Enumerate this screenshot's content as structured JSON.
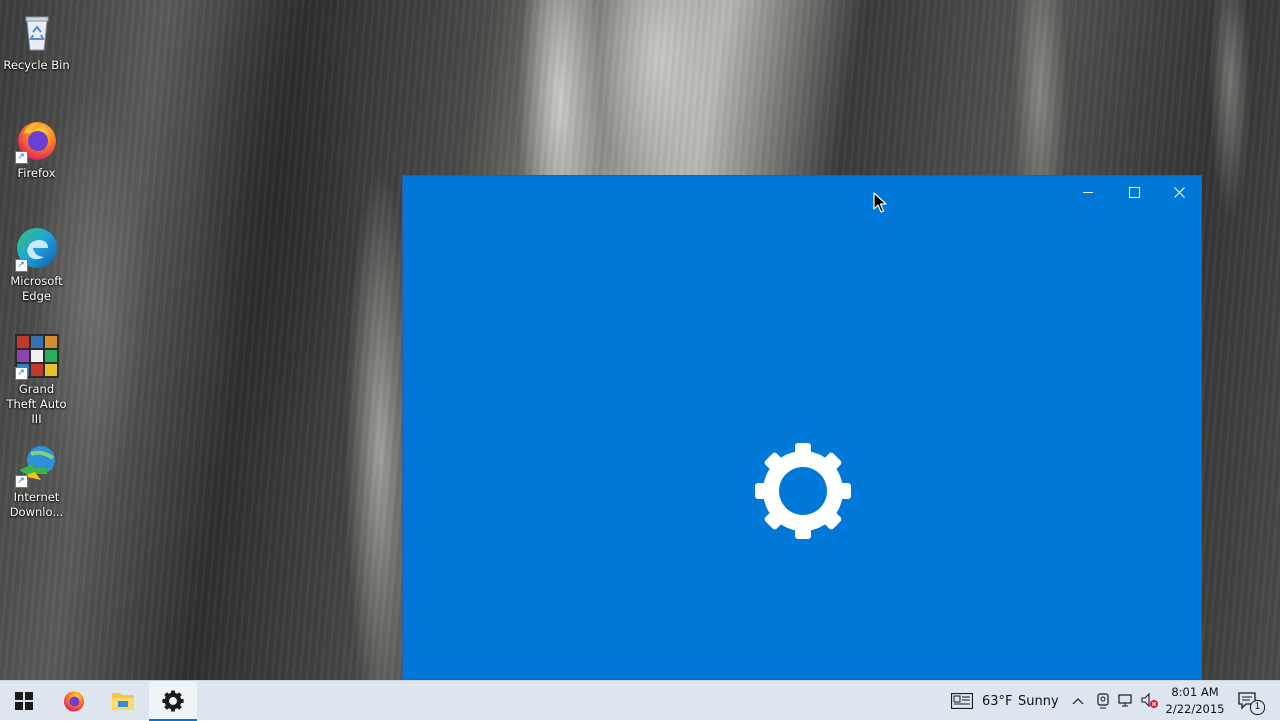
{
  "desktop": {
    "icons": [
      {
        "label": "Recycle Bin",
        "icon": "recycle-bin-icon"
      },
      {
        "label": "Firefox",
        "icon": "firefox-icon"
      },
      {
        "label": "Microsoft Edge",
        "icon": "edge-icon"
      },
      {
        "label": "Grand Theft Auto III",
        "icon": "gta3-icon"
      },
      {
        "label": "Internet Downlo...",
        "icon": "internet-download-manager-icon"
      }
    ]
  },
  "window": {
    "app": "Settings",
    "splash_icon": "gear-icon",
    "background_color": "#0078d7",
    "controls": {
      "minimize": "minimize-icon",
      "maximize": "maximize-icon",
      "close": "close-icon"
    }
  },
  "taskbar": {
    "start_icon": "windows-start-icon",
    "pinned": [
      {
        "name": "Firefox",
        "icon": "firefox-icon",
        "active": false
      },
      {
        "name": "File Explorer",
        "icon": "folder-icon",
        "active": false
      },
      {
        "name": "Settings",
        "icon": "gear-icon",
        "active": true
      }
    ],
    "weather": {
      "icon": "news-weather-icon",
      "temperature": "63°F",
      "condition": "Sunny"
    },
    "tray": {
      "overflow_icon": "chevron-up-icon",
      "icons": [
        "meet-now-icon",
        "network-icon",
        "volume-muted-icon"
      ]
    },
    "clock": {
      "time": "8:01 AM",
      "date": "2/22/2015"
    },
    "notifications": {
      "icon": "action-center-icon",
      "count": "1"
    },
    "accent_color": "#0078d7"
  }
}
